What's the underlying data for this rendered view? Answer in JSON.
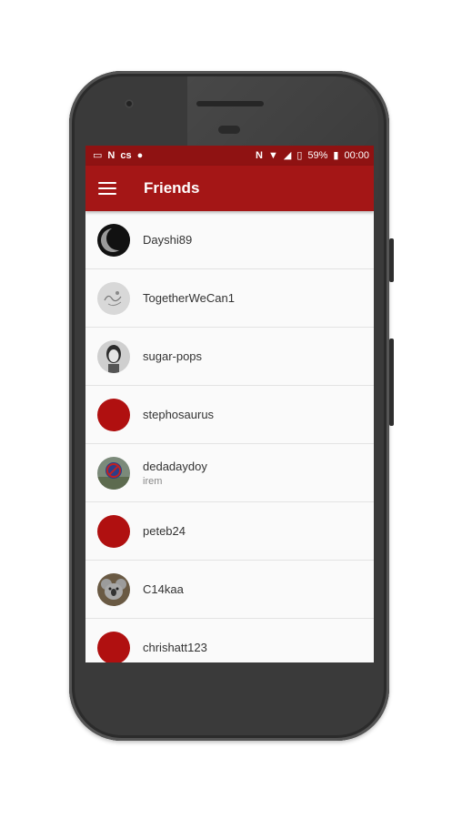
{
  "status_bar": {
    "battery": "59%",
    "time": "00:00"
  },
  "app_bar": {
    "title": "Friends"
  },
  "friends": [
    {
      "username": "Dayshi89",
      "subtitle": "",
      "avatar": "moon-photo"
    },
    {
      "username": "TogetherWeCan1",
      "subtitle": "",
      "avatar": "sketch-photo"
    },
    {
      "username": "sugar-pops",
      "subtitle": "",
      "avatar": "portrait-photo"
    },
    {
      "username": "stephosaurus",
      "subtitle": "",
      "avatar": "default-red"
    },
    {
      "username": "dedadaydoy",
      "subtitle": "irem",
      "avatar": "sign-photo"
    },
    {
      "username": "peteb24",
      "subtitle": "",
      "avatar": "default-red"
    },
    {
      "username": "C14kaa",
      "subtitle": "",
      "avatar": "koala-photo"
    },
    {
      "username": "chrishatt123",
      "subtitle": "",
      "avatar": "default-red"
    }
  ],
  "colors": {
    "status_bar": "#8f1212",
    "app_bar": "#a41616",
    "default_avatar": "#b01010"
  }
}
